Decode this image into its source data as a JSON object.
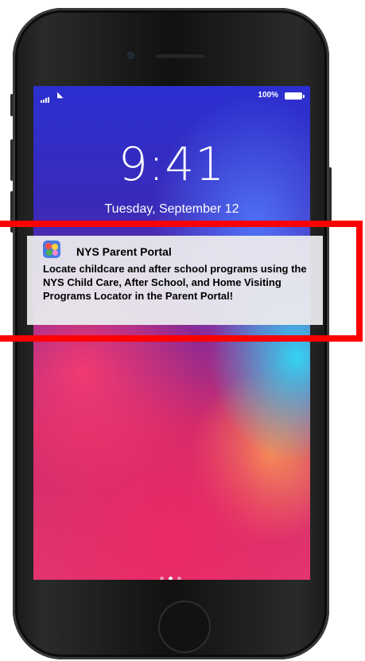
{
  "status_bar": {
    "battery": "100%"
  },
  "lock_screen": {
    "time": "9:41",
    "date": "Tuesday, September 12"
  },
  "notification": {
    "app_name": "NYS Parent Portal",
    "body": "Locate childcare and after school programs using the NYS Child Care, After School, and Home Visiting Programs Locator in the Parent Portal!"
  },
  "colors": {
    "highlight": "#ff0000"
  },
  "icons": [
    "signal-icon",
    "wifi-icon",
    "battery-icon",
    "lock-icon",
    "app-icon"
  ]
}
